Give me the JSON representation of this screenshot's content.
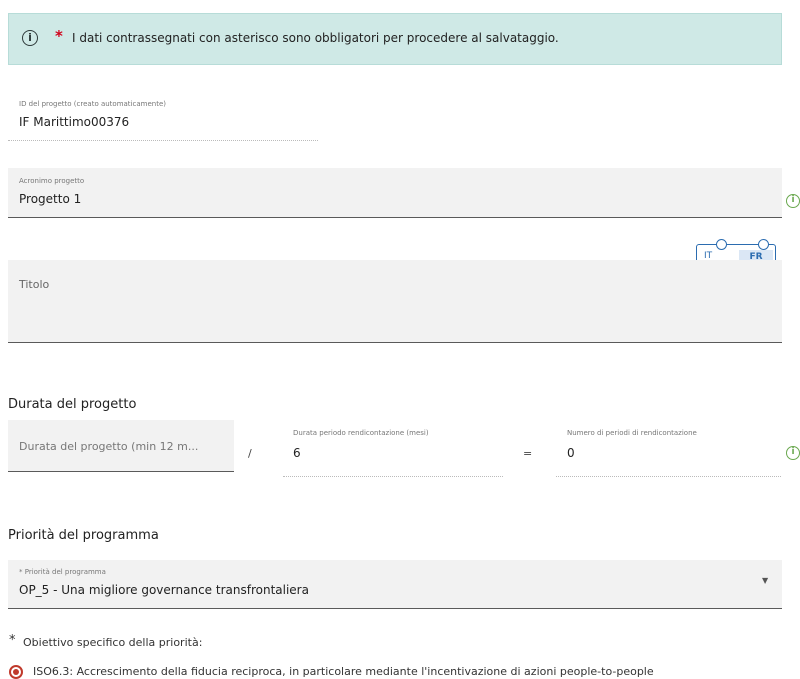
{
  "banner": {
    "icon": "info-icon",
    "asterisk": "*",
    "text": "I dati contrassegnati con asterisco sono obbligatori per procedere al salvataggio."
  },
  "project_id": {
    "label": "ID del progetto (creato automaticamente)",
    "value": "IF Marittimo00376"
  },
  "acronym": {
    "label": "Acronimo progetto",
    "value": "Progetto 1"
  },
  "title": {
    "placeholder": "Titolo",
    "languages": [
      "IT",
      "FR"
    ],
    "selected_language": "FR"
  },
  "duration": {
    "heading": "Durata del progetto",
    "input_placeholder": "Durata del progetto (min 12 m...",
    "slash": "/",
    "period_label": "Durata periodo rendicontazione (mesi)",
    "period_value": "6",
    "equals": "=",
    "count_label": "Numero di periodi di rendicontazione",
    "count_value": "0"
  },
  "priority": {
    "heading": "Priorità del programma",
    "select_label": "* Priorità del programma",
    "select_value": "OP_5 - Una migliore governance transfrontaliera"
  },
  "objective": {
    "asterisk": "*",
    "label": "Obiettivo specifico della priorità:",
    "option_text": "ISO6.3: Accrescimento della fiducia reciproca, in particolare mediante l'incentivazione di azioni people-to-people"
  },
  "colors": {
    "banner_bg": "#cfe9e6",
    "accent_blue": "#2b6cb0",
    "info_green": "#6aa84f",
    "radio_red": "#c0392b"
  }
}
